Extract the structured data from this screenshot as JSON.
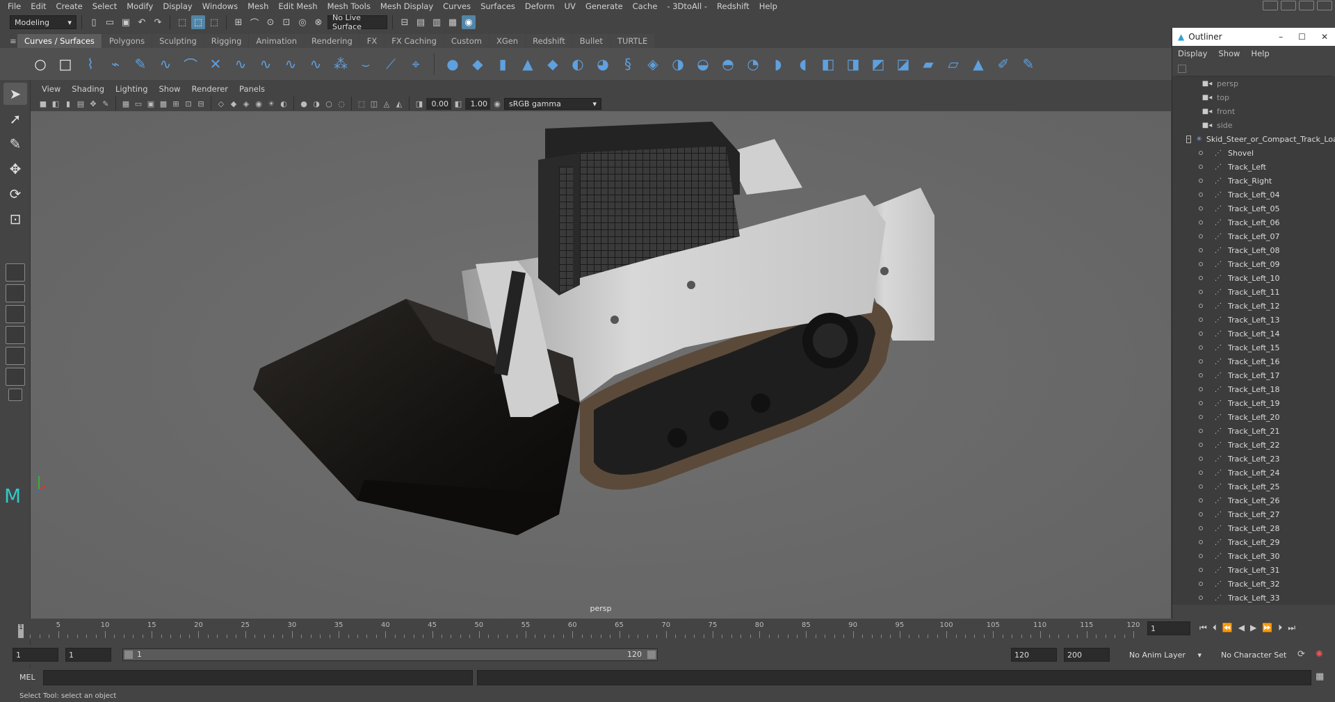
{
  "menubar": {
    "items": [
      "File",
      "Edit",
      "Create",
      "Select",
      "Modify",
      "Display",
      "Windows",
      "Mesh",
      "Edit Mesh",
      "Mesh Tools",
      "Mesh Display",
      "Curves",
      "Surfaces",
      "Deform",
      "UV",
      "Generate",
      "Cache",
      "- 3DtoAll -",
      "Redshift",
      "Help"
    ]
  },
  "statusline": {
    "mode": "Modeling",
    "live_surface": "No Live Surface"
  },
  "shelf": {
    "tabs": [
      "Curves / Surfaces",
      "Polygons",
      "Sculpting",
      "Rigging",
      "Animation",
      "Rendering",
      "FX",
      "FX Caching",
      "Custom",
      "XGen",
      "Redshift",
      "Bullet",
      "TURTLE"
    ],
    "active_tab": "Curves / Surfaces"
  },
  "viewport": {
    "menu": [
      "View",
      "Shading",
      "Lighting",
      "Show",
      "Renderer",
      "Panels"
    ],
    "exposure": "0.00",
    "gamma": "1.00",
    "colorspace": "sRGB gamma",
    "camera_label": "persp"
  },
  "outliner": {
    "title": "Outliner",
    "menu": [
      "Display",
      "Show",
      "Help"
    ],
    "cameras": [
      "persp",
      "top",
      "front",
      "side"
    ],
    "root": "Skid_Steer_or_Compact_Track_Loader",
    "children": [
      "Shovel",
      "Track_Left",
      "Track_Right",
      "Track_Left_04",
      "Track_Left_05",
      "Track_Left_06",
      "Track_Left_07",
      "Track_Left_08",
      "Track_Left_09",
      "Track_Left_10",
      "Track_Left_11",
      "Track_Left_12",
      "Track_Left_13",
      "Track_Left_14",
      "Track_Left_15",
      "Track_Left_16",
      "Track_Left_17",
      "Track_Left_18",
      "Track_Left_19",
      "Track_Left_20",
      "Track_Left_21",
      "Track_Left_22",
      "Track_Left_23",
      "Track_Left_24",
      "Track_Left_25",
      "Track_Left_26",
      "Track_Left_27",
      "Track_Left_28",
      "Track_Left_29",
      "Track_Left_30",
      "Track_Left_31",
      "Track_Left_32",
      "Track_Left_33"
    ]
  },
  "timeslider": {
    "ticks": [
      5,
      10,
      15,
      20,
      25,
      30,
      35,
      40,
      45,
      50,
      55,
      60,
      65,
      70,
      75,
      80,
      85,
      90,
      95,
      100,
      105,
      110,
      115,
      120
    ],
    "current_frame_marker": "1",
    "current_frame": "1"
  },
  "rangeslider": {
    "start": "1",
    "playback_start": "1",
    "range_start": "1",
    "range_end": "120",
    "playback_end": "120",
    "end": "200",
    "anim_layer": "No Anim Layer",
    "character_set": "No Character Set"
  },
  "cmdline": {
    "lang": "MEL"
  },
  "helpline": {
    "text": "Select Tool: select an object"
  }
}
